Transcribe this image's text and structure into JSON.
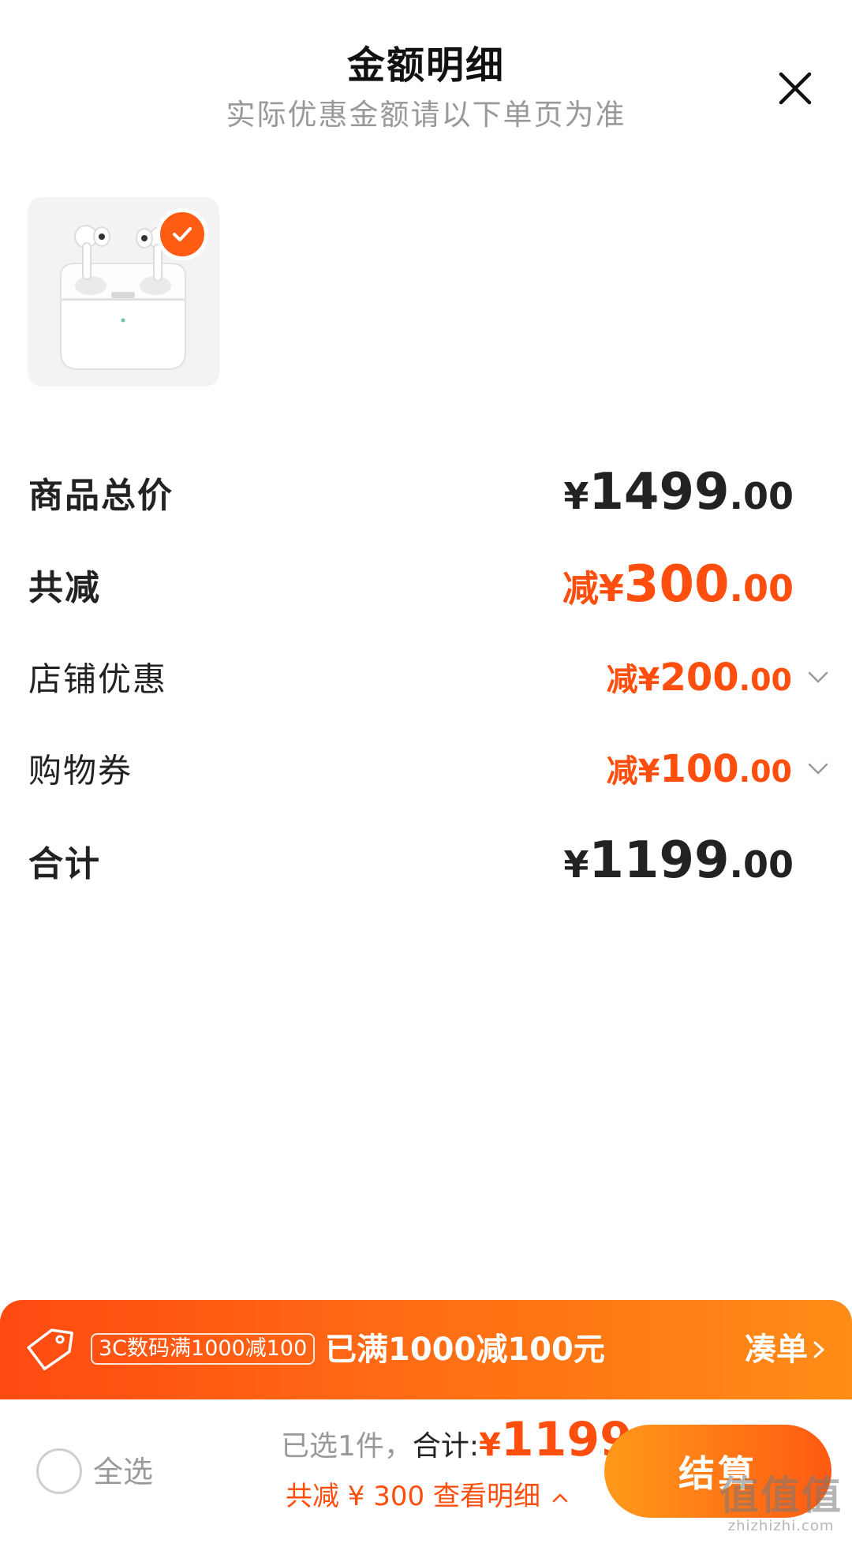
{
  "header": {
    "title": "金额明细",
    "subtitle": "实际优惠金额请以下单页为准"
  },
  "colors": {
    "accent": "#ff4e0d",
    "promo_gradient_start": "#ff4a12",
    "promo_gradient_end": "#ff8c16",
    "checkout_gradient_start": "#ff9a1a",
    "checkout_gradient_end": "#ff5a12"
  },
  "product": {
    "image_icon": "airpods-pro-icon",
    "selected": true
  },
  "breakdown": {
    "total_price": {
      "label": "商品总价",
      "currency": "¥",
      "integer": "1499",
      "decimal": ".00"
    },
    "total_discount": {
      "label": "共减",
      "prefix": "减",
      "currency": "¥",
      "integer": "300",
      "decimal": ".00"
    },
    "shop_discount": {
      "label": "店铺优惠",
      "prefix": "减",
      "currency": "¥",
      "integer": "200",
      "decimal": ".00"
    },
    "coupon": {
      "label": "购物券",
      "prefix": "减",
      "currency": "¥",
      "integer": "100",
      "decimal": ".00"
    },
    "subtotal": {
      "label": "合计",
      "currency": "¥",
      "integer": "1199",
      "decimal": ".00"
    }
  },
  "promo": {
    "chip": "3C数码满1000减100",
    "message": "已满1000减100元",
    "action": "凑单"
  },
  "bottom_bar": {
    "select_all": "全选",
    "selected_count": "已选1件，",
    "total_label": "合计:",
    "currency": "¥",
    "total_amount": "1199",
    "discount_summary": "共减 ¥ 300  查看明细",
    "checkout": "结算"
  },
  "watermark": {
    "logo": "值值值",
    "url": "zhizhizhi.com"
  }
}
